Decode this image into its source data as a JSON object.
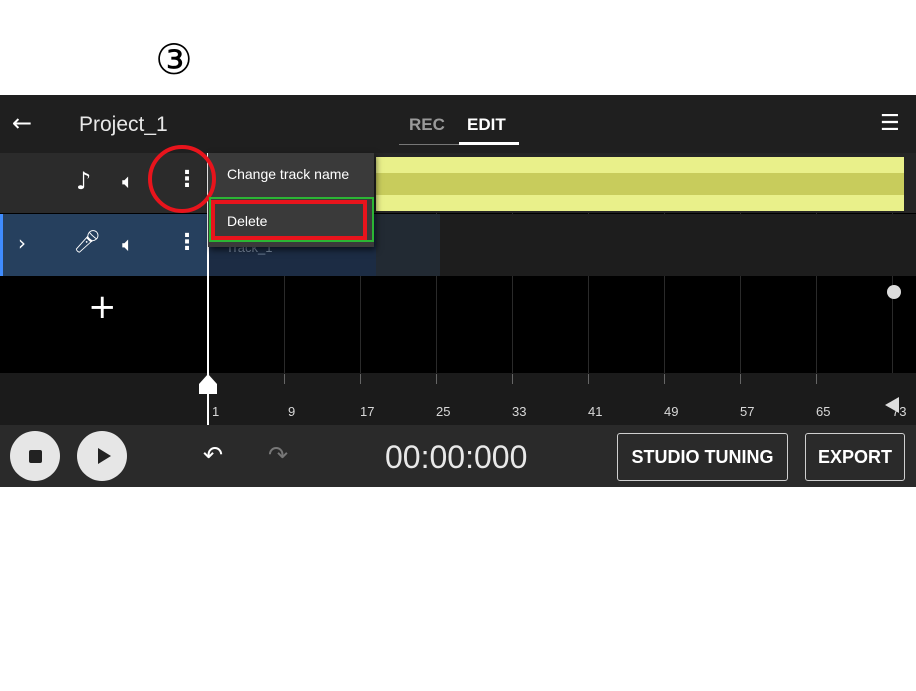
{
  "annotation": {
    "step_label": "③"
  },
  "header": {
    "back_icon": "arrow-left-icon",
    "project_title": "Project_1",
    "tab_rec": "REC",
    "tab_edit": "EDIT",
    "active_tab": "EDIT",
    "menu_icon": "hamburger-icon"
  },
  "tracks": [
    {
      "type_icon": "music-note-icon",
      "volume_icon": "speaker-icon",
      "more_icon": "more-vertical-icon"
    },
    {
      "expand_icon": "chevron-right-icon",
      "type_icon": "microphone-icon",
      "volume_icon": "speaker-icon",
      "more_icon": "more-vertical-icon",
      "clip_label": "Track_1"
    }
  ],
  "context_menu": {
    "items": [
      "Change track name",
      "Delete"
    ],
    "highlighted": "Delete"
  },
  "timeline": {
    "add_track_icon": "plus-icon",
    "mixer_icon": "sliders-icon",
    "ruler_labels": [
      "1",
      "9",
      "17",
      "25",
      "33",
      "41",
      "49",
      "57",
      "65",
      "73"
    ]
  },
  "transport": {
    "stop_icon": "stop-icon",
    "play_icon": "play-icon",
    "undo_icon": "undo-icon",
    "redo_icon": "redo-icon",
    "time": "00:00:000",
    "studio_tuning_label": "STUDIO TUNING",
    "export_label": "EXPORT"
  },
  "colors": {
    "waveform": "#e9f08a",
    "selected_track": "#26405e",
    "annotation_red": "#e8141c",
    "annotation_green": "#2bb534"
  }
}
